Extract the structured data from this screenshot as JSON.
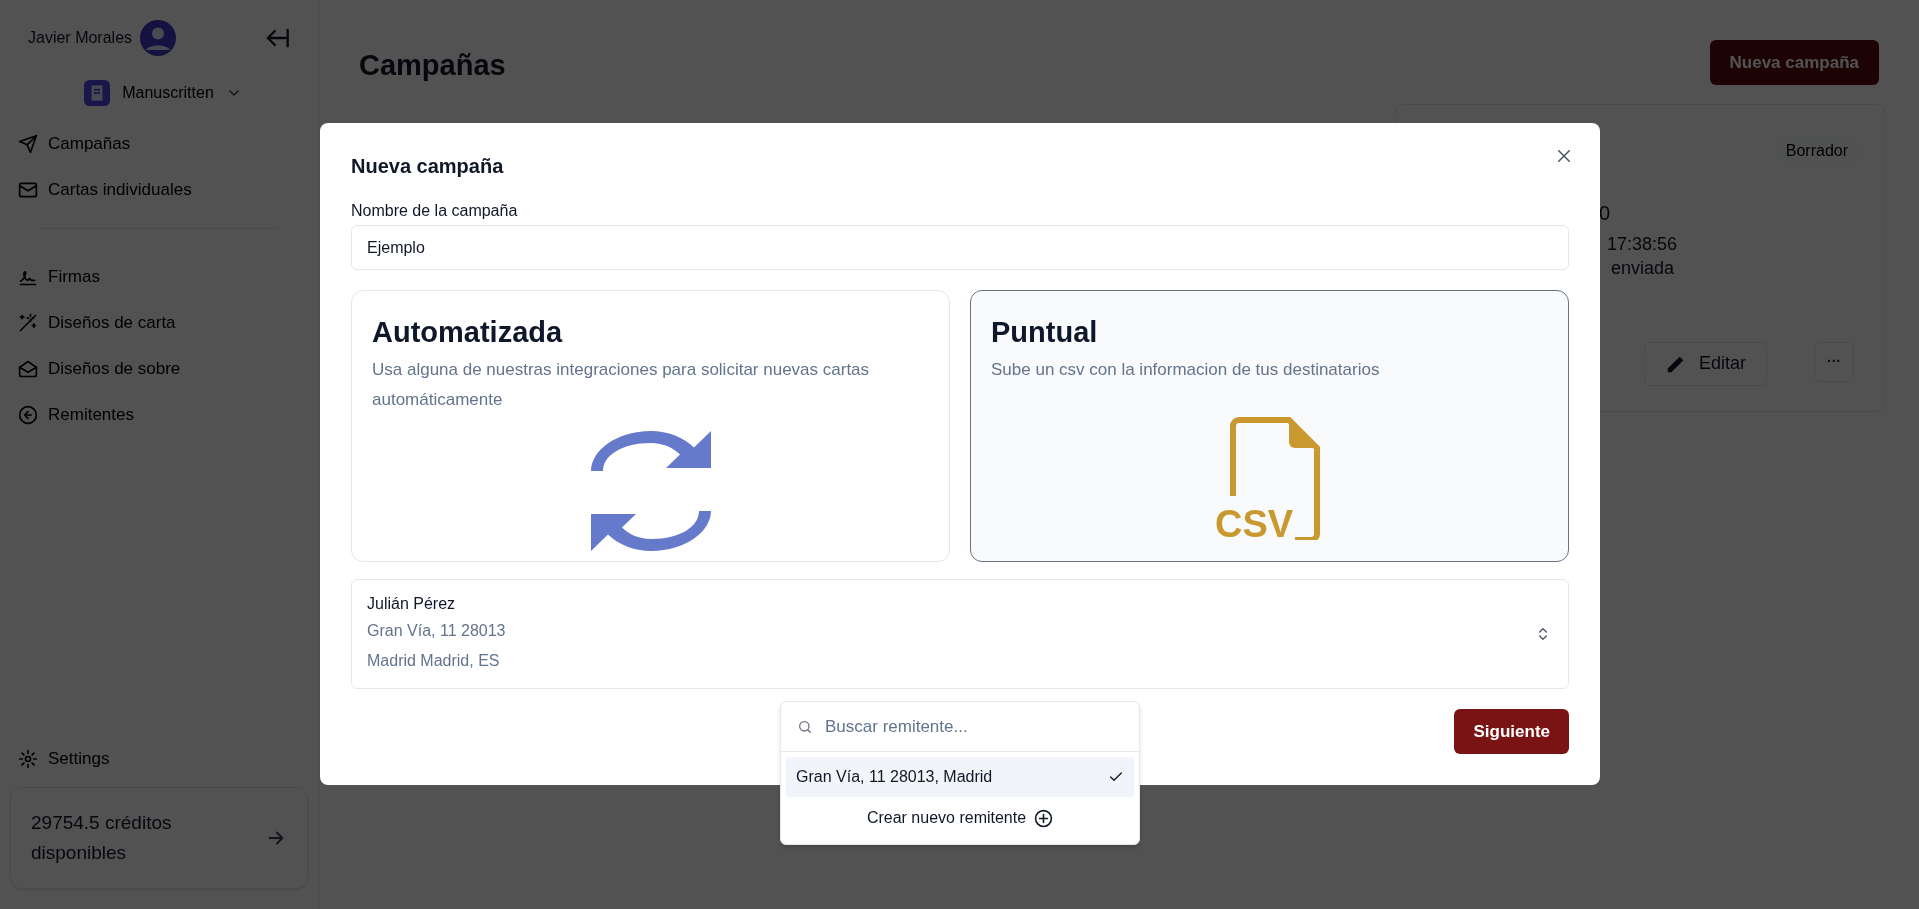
{
  "sidebar": {
    "user_name": "Javier Morales",
    "organization": "Manuscritten",
    "nav_groups": [
      [
        {
          "kind": "send",
          "label": "Campañas"
        },
        {
          "kind": "mail",
          "label": "Cartas individuales"
        }
      ],
      [
        {
          "kind": "signature",
          "label": "Firmas"
        },
        {
          "kind": "wand",
          "label": "Diseños de carta"
        },
        {
          "kind": "envelope",
          "label": "Diseños de sobre"
        },
        {
          "kind": "back",
          "label": "Remitentes"
        }
      ]
    ],
    "settings": "Settings",
    "credits": "29754.5 créditos disponibles"
  },
  "main": {
    "title": "Campañas",
    "new_button": "Nueva campaña",
    "card": {
      "status": "Borrador",
      "fragment_1": "0",
      "fragment_2": "17:38:56",
      "fragment_3": "enviada",
      "edit_button": "Editar",
      "more_button": "···"
    }
  },
  "modal": {
    "title": "Nueva campaña",
    "name_label": "Nombre de la campaña",
    "name_value": "Ejemplo",
    "options": [
      {
        "kind": "automatic",
        "title": "Automatizada",
        "description": "Usa alguna de nuestras integraciones para solicitar nuevas cartas automáticamente",
        "selected": false
      },
      {
        "kind": "csv",
        "title": "Puntual",
        "description": "Sube un csv con la informacion de tus destinatarios",
        "icon_label": "CSV",
        "selected": true
      }
    ],
    "sender": {
      "name": "Julián Pérez",
      "line_1": "Gran Vía, 11 28013",
      "line_2": "Madrid Madrid, ES"
    },
    "next_button": "Siguiente",
    "dropdown": {
      "search_placeholder": "Buscar remitente...",
      "items": [
        {
          "label": "Gran Vía, 11 28013, Madrid",
          "selected": true
        }
      ],
      "create_label": "Crear nuevo remitente"
    }
  }
}
